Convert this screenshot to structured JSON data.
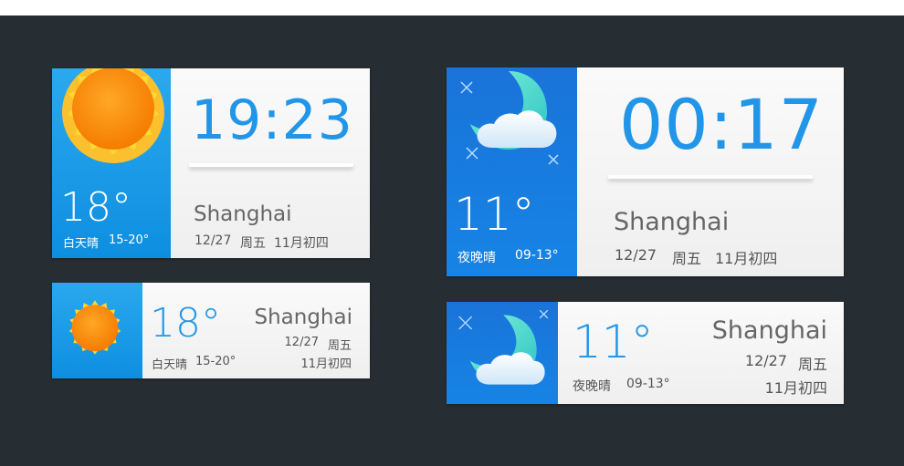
{
  "widgets": {
    "day_large": {
      "time": "19:23",
      "temp": "18°",
      "condition": "白天晴",
      "range": "15-20°",
      "city": "Shanghai",
      "date": "12/27",
      "weekday": "周五",
      "lunar": "11月初四",
      "icon": "sun-icon"
    },
    "day_small": {
      "temp": "18°",
      "condition": "白天晴",
      "range": "15-20°",
      "city": "Shanghai",
      "date": "12/27",
      "weekday": "周五",
      "lunar": "11月初四",
      "icon": "sun-icon"
    },
    "night_large": {
      "time": "00:17",
      "temp": "11°",
      "condition": "夜晚晴",
      "range": "09-13°",
      "city": "Shanghai",
      "date": "12/27",
      "weekday": "周五",
      "lunar": "11月初四",
      "icon": "moon-cloud-icon"
    },
    "night_small": {
      "temp": "11°",
      "condition": "夜晚晴",
      "range": "09-13°",
      "city": "Shanghai",
      "date": "12/27",
      "weekday": "周五",
      "lunar": "11月初四",
      "icon": "moon-cloud-icon"
    }
  },
  "colors": {
    "background": "#272e33",
    "accent_blue": "#2196e8",
    "day_panel": "#14a0eb",
    "night_panel": "#1a73d9",
    "sun": "#f7a21b"
  }
}
